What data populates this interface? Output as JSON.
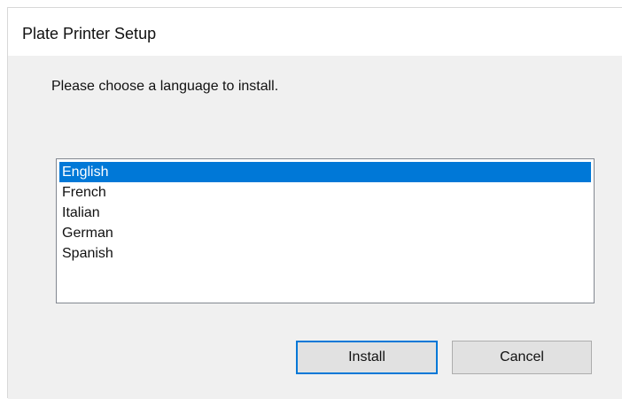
{
  "window": {
    "title": "Plate Printer Setup"
  },
  "prompt": "Please choose a language to install.",
  "languages": {
    "items": [
      {
        "label": "English",
        "selected": true
      },
      {
        "label": "French",
        "selected": false
      },
      {
        "label": "Italian",
        "selected": false
      },
      {
        "label": "German",
        "selected": false
      },
      {
        "label": "Spanish",
        "selected": false
      }
    ]
  },
  "buttons": {
    "install_label": "Install",
    "cancel_label": "Cancel"
  },
  "colors": {
    "selection": "#0078d7",
    "dialog_background": "#f0f0f0",
    "default_button_border": "#0078d7"
  }
}
